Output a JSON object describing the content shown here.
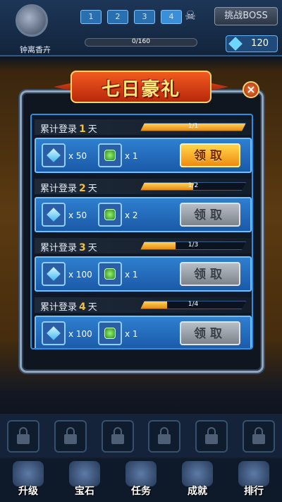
{
  "player": {
    "name": "钟离香卉"
  },
  "stage": {
    "boxes": [
      "1",
      "2",
      "3",
      "4"
    ],
    "boss_button": "挑战BOSS"
  },
  "progress": {
    "label": "0/160",
    "fraction": 0.0
  },
  "currency": {
    "gems": "120"
  },
  "dialog": {
    "title": "七日豪礼",
    "close_label": "×",
    "days": [
      {
        "prefix": "累计登录",
        "day": "1",
        "suffix": "天",
        "progress_label": "1/1",
        "progress": 1.0,
        "reward1_qty": "x 50",
        "reward2_qty": "x 1",
        "claim_label": "领取",
        "claimable": true
      },
      {
        "prefix": "累计登录",
        "day": "2",
        "suffix": "天",
        "progress_label": "1/2",
        "progress": 0.5,
        "reward1_qty": "x 50",
        "reward2_qty": "x 2",
        "claim_label": "领取",
        "claimable": false
      },
      {
        "prefix": "累计登录",
        "day": "3",
        "suffix": "天",
        "progress_label": "1/3",
        "progress": 0.333,
        "reward1_qty": "x 100",
        "reward2_qty": "x 1",
        "claim_label": "领取",
        "claimable": false
      },
      {
        "prefix": "累计登录",
        "day": "4",
        "suffix": "天",
        "progress_label": "1/4",
        "progress": 0.25,
        "reward1_qty": "x 100",
        "reward2_qty": "x 1",
        "claim_label": "领取",
        "claimable": false
      }
    ]
  },
  "bottom_nav": [
    "升级",
    "宝石",
    "任务",
    "成就",
    "排行"
  ],
  "colors": {
    "accent": "#2c8fe6",
    "claim_active": "#f5a623",
    "claim_disabled": "#9aa1aa",
    "day_number": "#f5c13a"
  }
}
